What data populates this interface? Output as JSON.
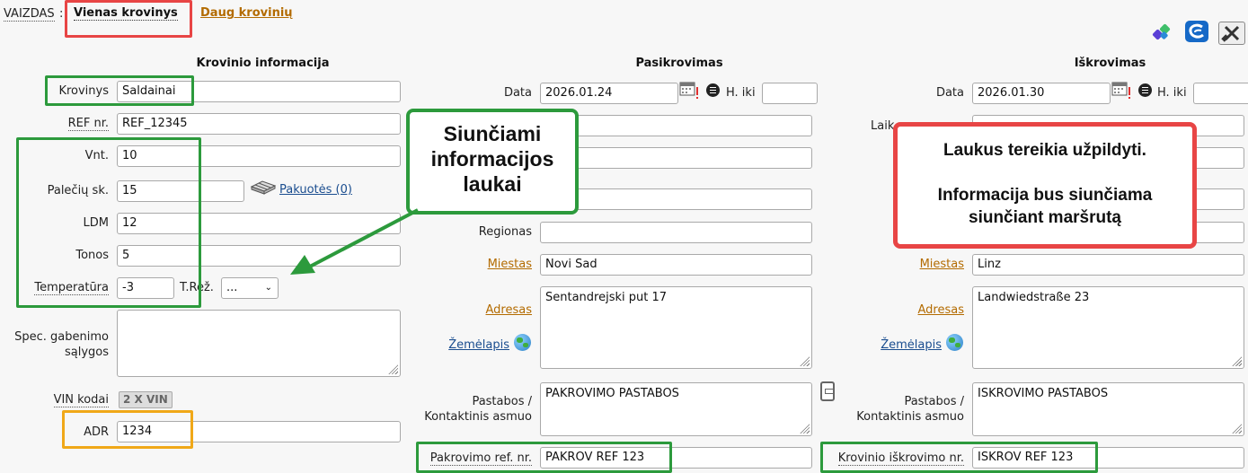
{
  "view": {
    "label": "VAIZDAS",
    "tab_single": "Vienas krovinys",
    "tab_multi": "Daug krovinių"
  },
  "cargo": {
    "title": "Krovinio informacija",
    "cargo_label": "Krovinys",
    "cargo_value": "Saldainai",
    "ref_label": "REF nr.",
    "ref_value": "REF_12345",
    "units_label": "Vnt.",
    "units_value": "10",
    "pallets_label": "Palečių sk.",
    "pallets_value": "15",
    "packages_link": "Pakuotės (0)",
    "ldm_label": "LDM",
    "ldm_value": "12",
    "tons_label": "Tonos",
    "tons_value": "5",
    "temp_label": "Temperatūra",
    "temp_value": "-3",
    "mode_label": "T.Rež.",
    "mode_value": "...",
    "special_label_1": "Spec. gabenimo",
    "special_label_2": "sąlygos",
    "special_value": "",
    "vin_label": "VIN kodai",
    "vin_button": "2 X VIN",
    "adr_label": "ADR",
    "adr_value": "1234"
  },
  "loading": {
    "title": "Pasikrovimas",
    "date_label": "Data",
    "date_value": "2026.01.24",
    "h_label": "H. iki",
    "h_value": "",
    "region_label": "Regionas",
    "region_value": "",
    "city_label": "Miestas",
    "city_value": "Novi Sad",
    "address_label": "Adresas",
    "address_value": "Sentandrejski put 17",
    "map_label": "Žemėlapis",
    "notes_label_1": "Pastabos /",
    "notes_label_2": "Kontaktinis asmuo",
    "notes_value": "PAKROVIMO PASTABOS",
    "ref_label": "Pakrovimo ref. nr.",
    "ref_value": "PAKROV REF 123"
  },
  "unloading": {
    "title": "Iškrovimas",
    "date_label": "Data",
    "date_value": "2026.01.30",
    "h_label": "H. iki",
    "h_value": "",
    "time_label_partial": "Laik",
    "city_label": "Miestas",
    "city_value": "Linz",
    "address_label": "Adresas",
    "address_value": "Landwiedstraße 23",
    "map_label": "Žemėlapis",
    "notes_label_1": "Pastabos /",
    "notes_label_2": "Kontaktinis asmuo",
    "notes_value": "ISKROVIMO PASTABOS",
    "ref_label": "Krovinio iškrovimo nr.",
    "ref_value": "ISKROV REF 123"
  },
  "callouts": {
    "green_line1": "Siunčiami",
    "green_line2": "informacijos",
    "green_line3": "laukai",
    "red_line1": "Laukus tereikia užpildyti.",
    "red_line2": "Informacija bus siunčiama",
    "red_line3": "siunčiant maršrutą"
  },
  "colors": {
    "highlight_green": "#2c9a3c",
    "highlight_red": "#e84545",
    "highlight_orange": "#f0a818",
    "link_orange": "#b36b00"
  }
}
